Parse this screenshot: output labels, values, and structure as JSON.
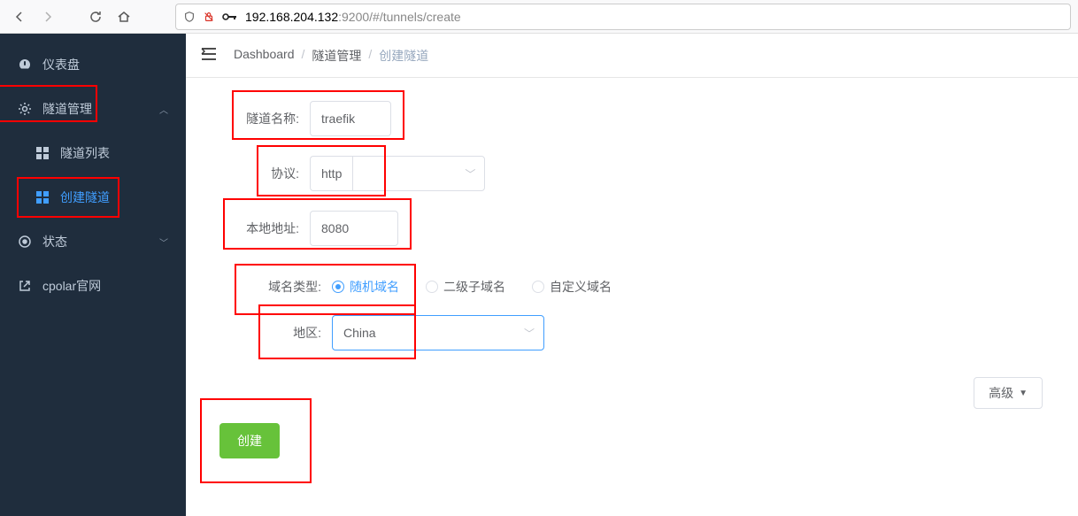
{
  "browser": {
    "url_host": "192.168.204.132",
    "url_path": ":9200/#/tunnels/create"
  },
  "sidebar": {
    "items": [
      {
        "label": "仪表盘",
        "icon": "dashboard"
      },
      {
        "label": "隧道管理",
        "icon": "gear",
        "expanded": true,
        "children": [
          {
            "label": "隧道列表",
            "icon": "grid"
          },
          {
            "label": "创建隧道",
            "icon": "grid",
            "active": true
          }
        ]
      },
      {
        "label": "状态",
        "icon": "circle"
      },
      {
        "label": "cpolar官网",
        "icon": "external"
      }
    ]
  },
  "breadcrumb": {
    "items": [
      "Dashboard",
      "隧道管理",
      "创建隧道"
    ]
  },
  "form": {
    "tunnel_name": {
      "label": "隧道名称:",
      "value": "traefik"
    },
    "protocol": {
      "label": "协议:",
      "value": "http"
    },
    "local_addr": {
      "label": "本地地址:",
      "value": "8080"
    },
    "domain_type": {
      "label": "域名类型:",
      "options": [
        "随机域名",
        "二级子域名",
        "自定义域名"
      ],
      "selected": 0
    },
    "region": {
      "label": "地区:",
      "value": "China"
    },
    "advanced": "高级",
    "submit": "创建"
  }
}
